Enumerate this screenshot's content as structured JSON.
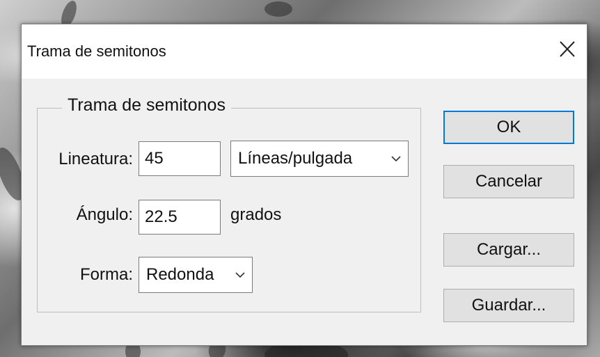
{
  "window": {
    "title": "Trama de semitonos"
  },
  "group": {
    "legend": "Trama de semitonos"
  },
  "fields": {
    "lineatura": {
      "label": "Lineatura:",
      "value": "45",
      "unit": "Líneas/pulgada"
    },
    "angulo": {
      "label": "Ángulo:",
      "value": "22.5",
      "unit": "grados"
    },
    "forma": {
      "label": "Forma:",
      "value": "Redonda"
    }
  },
  "buttons": {
    "ok": "OK",
    "cancel": "Cancelar",
    "load": "Cargar...",
    "save": "Guardar..."
  },
  "icons": {
    "close": "close-icon",
    "dropdown": "chevron-down-icon"
  }
}
